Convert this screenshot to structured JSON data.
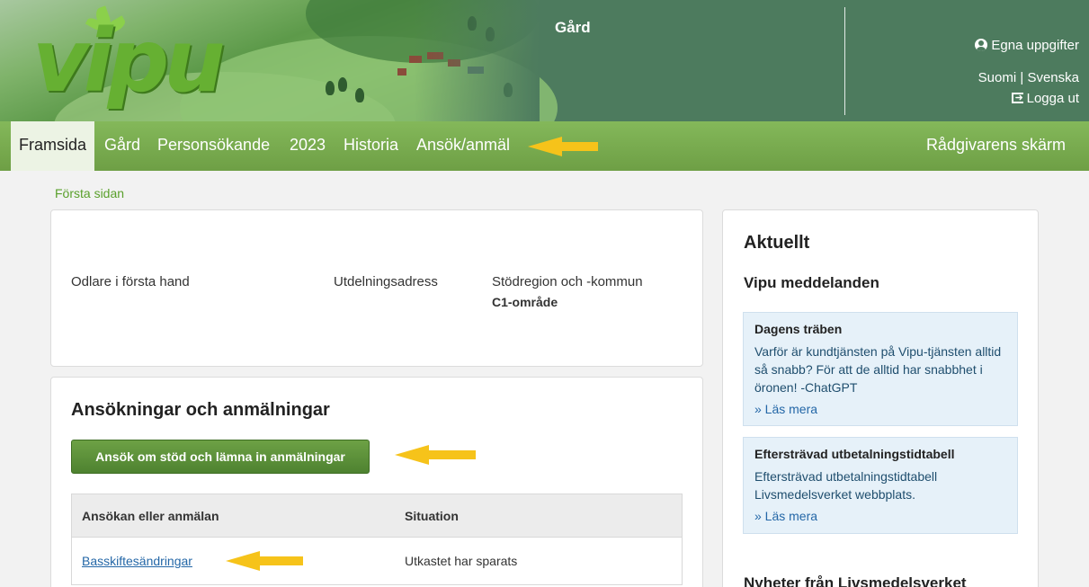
{
  "header": {
    "title": "Gård",
    "logo_text": "vipu",
    "user_links": {
      "own_info": "Egna uppgifter",
      "lang_fi": "Suomi",
      "lang_sep": "|",
      "lang_sv": "Svenska",
      "logout": "Logga ut"
    }
  },
  "nav": {
    "items": [
      {
        "label": "Framsida"
      },
      {
        "label": "Gård"
      },
      {
        "label": "Personsökande"
      },
      {
        "label": "2023"
      },
      {
        "label": "Historia"
      },
      {
        "label": "Ansök/anmäl"
      }
    ],
    "right": "Rådgivarens skärm"
  },
  "breadcrumb": "Första sidan",
  "info": {
    "grower_label": "Odlare i första hand",
    "address_label": "Utdelningsadress",
    "region_label": "Stödregion och -kommun",
    "region_value": "C1-område"
  },
  "applications": {
    "title": "Ansökningar och anmälningar",
    "apply_button": "Ansök om stöd och lämna in anmälningar",
    "columns": [
      "Ansökan eller anmälan",
      "Situation"
    ],
    "rows": [
      {
        "name": "Basskiftesändringar",
        "status": "Utkastet har sparats"
      }
    ]
  },
  "news": {
    "title": "Aktuellt",
    "subtitle": "Vipu meddelanden",
    "notices": [
      {
        "title": "Dagens träben",
        "body": "Varför är kundtjänsten på Vipu-tjänsten alltid så snabb? För att de alltid har snabbhet i öronen! -ChatGPT",
        "more": "» Läs mera"
      },
      {
        "title": "Eftersträvad utbetalningstidtabell",
        "body": "Eftersträvad utbetalningstidtabell Livsmedelsverket webbplats.",
        "more": "» Läs mera"
      }
    ],
    "subtitle2": "Nyheter från Livsmedelsverket"
  },
  "colors": {
    "header_bg": "#4d7b5e",
    "nav_bg": "#7aaf50",
    "accent_green": "#5aa02c",
    "link_blue": "#2467a7",
    "annotation_arrow": "#f6c31a"
  }
}
